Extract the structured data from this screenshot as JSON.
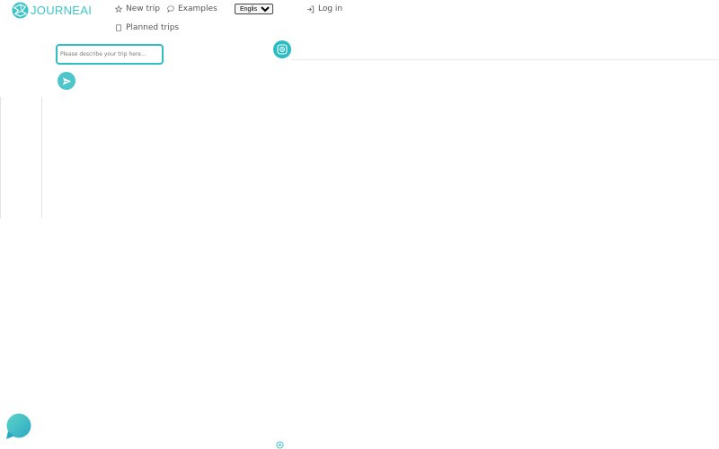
{
  "brand": {
    "name": "JOURNEAI",
    "accent": "#3ec3c7"
  },
  "nav": {
    "new_trip": "New trip",
    "examples": "Examples",
    "planned_trips": "Planned trips",
    "login": "Log in"
  },
  "language": {
    "selected": "English"
  },
  "trip_input": {
    "placeholder": "Please describe your trip here..."
  },
  "icons": {
    "new_trip": "star-icon",
    "examples": "speech-bubble-icon",
    "planned_trips": "bookmark-icon",
    "login": "login-icon",
    "send": "send-icon",
    "locate": "target-icon",
    "chat": "chat-bubble-icon"
  }
}
